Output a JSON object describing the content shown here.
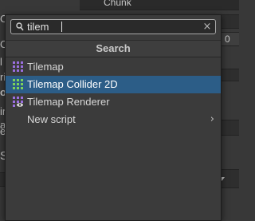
{
  "background": {
    "top_field_value": "Chunk",
    "right_field_value": "0",
    "left_letters": [
      "C",
      "C",
      "l",
      "ri",
      "or",
      "in",
      "a",
      "er",
      "Sp",
      "Sh"
    ]
  },
  "popup": {
    "search": {
      "value": "tilem",
      "placeholder": ""
    },
    "header": "Search",
    "results": [
      {
        "label": "Tilemap",
        "icon": "tilemap-grid-icon",
        "selected": false
      },
      {
        "label": "Tilemap Collider 2D",
        "icon": "tilemap-collider-2d-icon",
        "selected": true
      },
      {
        "label": "Tilemap Renderer",
        "icon": "tilemap-renderer-icon",
        "selected": false
      },
      {
        "label": "New script",
        "icon": "",
        "selected": false,
        "has_submenu": true
      }
    ]
  },
  "colors": {
    "selection": "#2c5d87",
    "tilemap_icon": "#9b6fe0",
    "collider_icon": "#7dd35a"
  }
}
